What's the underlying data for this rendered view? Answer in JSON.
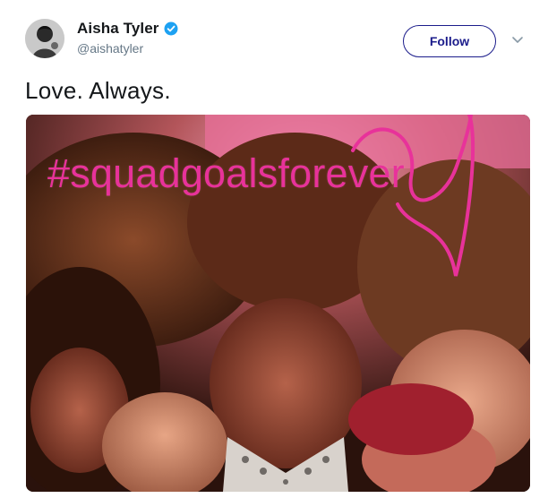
{
  "user": {
    "display_name": "Aisha Tyler",
    "handle": "@aishatyler",
    "verified": true,
    "avatar_icon": "profile-photo"
  },
  "actions": {
    "follow_label": "Follow",
    "menu_icon": "chevron-down-icon"
  },
  "tweet": {
    "text": "Love. Always."
  },
  "media": {
    "overlay_text": "#squadgoalsforever",
    "overlay_color": "#e8329a",
    "heart_icon": "heart-outline-icon"
  },
  "colors": {
    "follow_accent": "#1b1c8b",
    "verified_blue": "#1da1f2",
    "handle_gray": "#657786"
  }
}
